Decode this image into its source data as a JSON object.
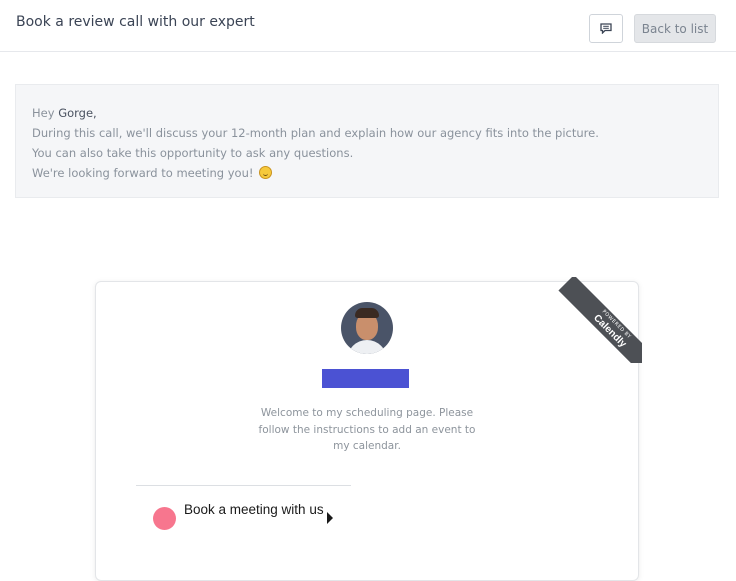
{
  "header": {
    "title": "Book a review call with our expert",
    "chat_icon": "chat-bubble-icon",
    "back_label": "Back to list"
  },
  "message": {
    "greeting": "Hey",
    "name": "Gorge,",
    "line1": "During this call, we'll discuss your 12-month plan and explain how our agency fits into the picture.",
    "line2": "You can also take this opportunity to ask any questions.",
    "line3": "We're looking forward to meeting you!",
    "emoji_icon": "smiley-emoji-icon"
  },
  "scheduler": {
    "ribbon_top": "POWERED BY",
    "ribbon_brand": "Calendly",
    "welcome": "Welcome to my scheduling page. Please follow the instructions to add an event to my calendar.",
    "event_label": "Book a meeting with us",
    "event_color": "#f7768e",
    "name_placeholder_color": "#4b52d3"
  }
}
